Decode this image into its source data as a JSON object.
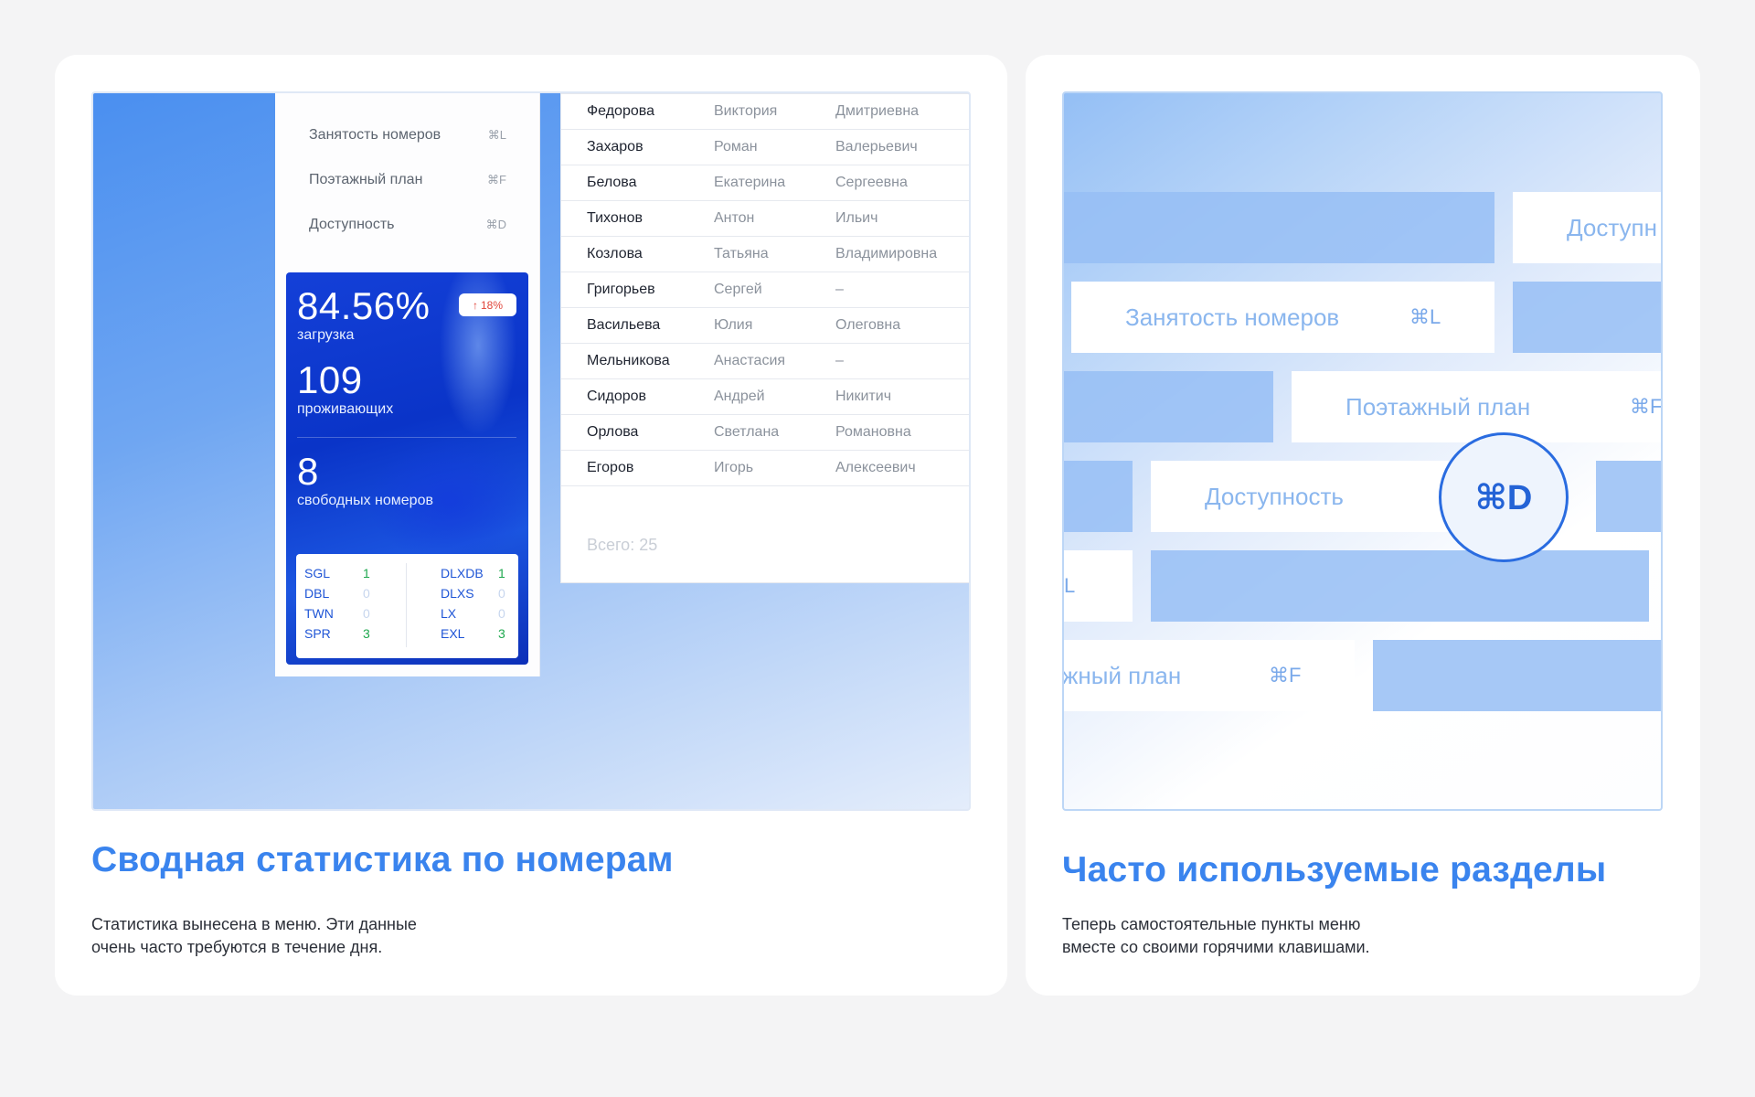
{
  "left_card": {
    "menu": [
      {
        "label": "Занятость номеров",
        "shortcut": "⌘L"
      },
      {
        "label": "Поэтажный план",
        "shortcut": "⌘F"
      },
      {
        "label": "Доступность",
        "shortcut": "⌘D"
      }
    ],
    "stats": {
      "load_value": "84.56%",
      "load_label": "загрузка",
      "delta": "18%",
      "delta_icon": "arrow-up-icon",
      "residents_value": "109",
      "residents_label": "проживающих",
      "free_value": "8",
      "free_label": "свободных номеров",
      "rooms_left": [
        {
          "code": "SGL",
          "count": "1"
        },
        {
          "code": "DBL",
          "count": "0"
        },
        {
          "code": "TWN",
          "count": "0"
        },
        {
          "code": "SPR",
          "count": "3"
        }
      ],
      "rooms_right": [
        {
          "code": "DLXDB",
          "count": "1"
        },
        {
          "code": "DLXS",
          "count": "0"
        },
        {
          "code": "LX",
          "count": "0"
        },
        {
          "code": "EXL",
          "count": "3"
        }
      ]
    },
    "guests": [
      {
        "last": "Федорова",
        "first": "Виктория",
        "middle": "Дмитриевна"
      },
      {
        "last": "Захаров",
        "first": "Роман",
        "middle": "Валерьевич"
      },
      {
        "last": "Белова",
        "first": "Екатерина",
        "middle": "Сергеевна"
      },
      {
        "last": "Тихонов",
        "first": "Антон",
        "middle": "Ильич"
      },
      {
        "last": "Козлова",
        "first": "Татьяна",
        "middle": "Владимировна"
      },
      {
        "last": "Григорьев",
        "first": "Сергей",
        "middle": "–"
      },
      {
        "last": "Васильева",
        "first": "Юлия",
        "middle": "Олеговна"
      },
      {
        "last": "Мельникова",
        "first": "Анастасия",
        "middle": "–"
      },
      {
        "last": "Сидоров",
        "first": "Андрей",
        "middle": "Никитич"
      },
      {
        "last": "Орлова",
        "first": "Светлана",
        "middle": "Романовна"
      },
      {
        "last": "Егоров",
        "first": "Игорь",
        "middle": "Алексеевич"
      }
    ],
    "total": "Всего: 25",
    "heading": "Сводная статистика по номерам",
    "desc_line1": "Статистика вынесена в меню. Эти данные",
    "desc_line2": "очень часто требуются в течение дня."
  },
  "right_card": {
    "blocks": {
      "availability_top": "Доступн",
      "occupancy": "Занятость номеров",
      "occupancy_sc": "⌘L",
      "floor_plan": "Поэтажный план",
      "floor_plan_sc": "⌘F",
      "availability": "Доступность",
      "l_fragment": "L",
      "floor_plan_fragment": "жный план",
      "floor_plan_fragment_sc": "⌘F"
    },
    "highlight_shortcut": "⌘D",
    "heading": "Часто используемые разделы",
    "desc_line1": "Теперь самостоятельные пункты меню",
    "desc_line2": "вместе со своими горячими клавишами."
  },
  "colors": {
    "accent": "#3a84ee",
    "stats_blue": "#0a34c8",
    "delta_red": "#e0453a",
    "count_green": "#1fa84f",
    "count_zero": "#c7d6ee"
  }
}
